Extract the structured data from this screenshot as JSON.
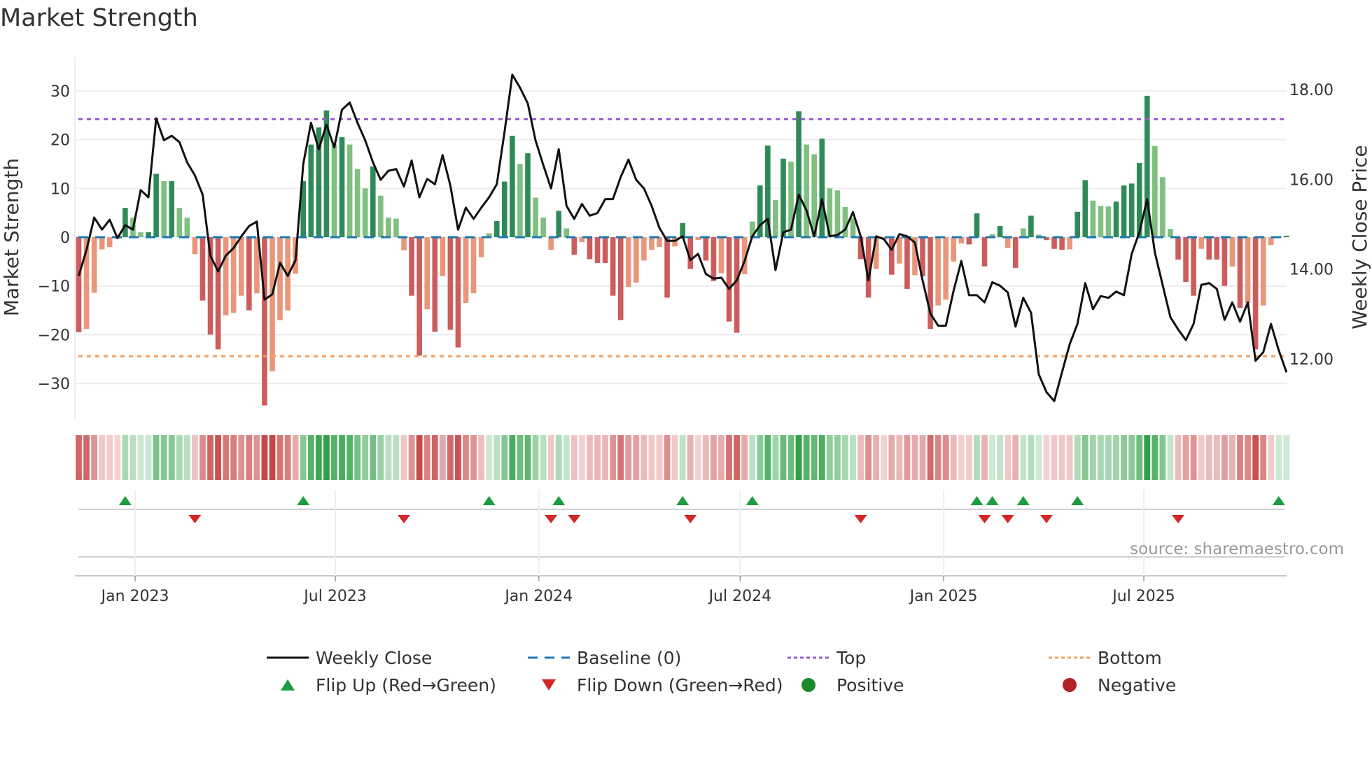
{
  "title": "Market Strength",
  "source": "source: sharemaestro.com",
  "legend": [
    {
      "label": "Weekly Close",
      "symbol": "line",
      "color": "#111111"
    },
    {
      "label": "Baseline (0)",
      "symbol": "dash",
      "color": "#1f77b4"
    },
    {
      "label": "Top",
      "symbol": "dot",
      "color": "#9b59d0"
    },
    {
      "label": "Bottom",
      "symbol": "dot",
      "color": "#f0a060"
    },
    {
      "label": "Flip Up (Red→Green)",
      "symbol": "up",
      "color": "#1a9e3f"
    },
    {
      "label": "Flip Down (Green→Red)",
      "symbol": "down",
      "color": "#d62728"
    },
    {
      "label": "Positive",
      "symbol": "circle",
      "color": "#1a8a2a"
    },
    {
      "label": "Negative",
      "symbol": "circle",
      "color": "#b22222"
    }
  ],
  "colors": {
    "pos_dark": "#2e8b57",
    "pos_light": "#7fbf7f",
    "neg_dark": "#cd5c5c",
    "neg_light": "#e9967a",
    "grid": "#ececf0"
  },
  "chart_data": {
    "type": "bar+line",
    "title": "Market Strength",
    "ylabel": "Market Strength",
    "y2label": "Weekly Close Price",
    "ylim": [
      -37,
      37
    ],
    "y2lim": [
      11.0,
      18.8
    ],
    "yticks": [
      "30",
      "20",
      "10",
      "0",
      "−10",
      "−20",
      "−30"
    ],
    "ytick_values": [
      30,
      20,
      10,
      0,
      -10,
      -20,
      -30
    ],
    "y2ticks": [
      "18.00",
      "16.00",
      "14.00",
      "12.00"
    ],
    "y2tick_values": [
      18,
      16,
      14,
      12
    ],
    "xticks": [
      {
        "label": "Jan 2023",
        "date": "2023-01-01"
      },
      {
        "label": "Jul 2023",
        "date": "2023-07-01"
      },
      {
        "label": "Jan 2024",
        "date": "2024-01-01"
      },
      {
        "label": "Jul 2024",
        "date": "2024-07-01"
      },
      {
        "label": "Jan 2025",
        "date": "2025-01-01"
      },
      {
        "label": "Jul 2025",
        "date": "2025-07-01"
      }
    ],
    "start_date": "2022-11-11",
    "frequency": "weekly",
    "top_level": 24.2,
    "bottom_level": -24.4,
    "baseline": 0,
    "strength": [
      -19.5,
      -18.8,
      -11.4,
      -2.5,
      -2,
      -0.3,
      6,
      4,
      1,
      1,
      13,
      11.5,
      11.5,
      6,
      4,
      -3.5,
      -13,
      -20,
      -23,
      -16,
      -15.5,
      -12,
      -15,
      -11.5,
      -34.5,
      -27.5,
      -17,
      -15,
      -7.5,
      11.5,
      19,
      22.5,
      26,
      19,
      20.5,
      19,
      14,
      10,
      14.5,
      8.5,
      4,
      3.8,
      -2.7,
      -12,
      -24.3,
      -14.8,
      -19.4,
      -8,
      -19,
      -22.6,
      -13.5,
      -11.5,
      -4.1,
      0.8,
      3.3,
      11.4,
      20.8,
      15,
      17.2,
      8.1,
      4,
      -2.6,
      5.4,
      1.8,
      -3.6,
      -1,
      -4.5,
      -5.3,
      -5.3,
      -12,
      -17,
      -10.2,
      -9.3,
      -4.8,
      -2.6,
      -2,
      -12.4,
      -1.9,
      2.9,
      -6.5,
      -0.6,
      -4.8,
      -9,
      -7.4,
      -17.3,
      -19.6,
      -7.6,
      3.2,
      10.6,
      18.8,
      7.6,
      16.1,
      15.5,
      25.8,
      19,
      17,
      20.2,
      10,
      9.6,
      6.2,
      3.9,
      -4.5,
      -12.4,
      -6.5,
      -0.5,
      -7.7,
      -5.4,
      -10.6,
      -7.8,
      -8,
      -18.8,
      -14,
      -12.8,
      -5,
      -1.3,
      -1.5,
      4.9,
      -6,
      0.6,
      2.3,
      -2.2,
      -6.3,
      1.8,
      4.4,
      0.5,
      -0.6,
      -2.4,
      -2.6,
      -2.5,
      5.2,
      11.7,
      7.5,
      6.4,
      6.3,
      7.3,
      10.6,
      11,
      15.2,
      29,
      18.7,
      12.3,
      1.7,
      -4.6,
      -9.2,
      -12,
      -2.4,
      -4.6,
      -4.6,
      -10,
      -6,
      -14.5,
      -13.5,
      -23,
      -14,
      -1.6,
      0.2,
      0.3
    ],
    "weekly_close": [
      13.85,
      14.43,
      15.15,
      14.88,
      15.1,
      14.69,
      14.98,
      14.88,
      15.76,
      15.6,
      17.36,
      16.87,
      16.97,
      16.83,
      16.38,
      16.09,
      15.66,
      14.3,
      13.95,
      14.3,
      14.47,
      14.73,
      14.96,
      15.06,
      13.32,
      13.44,
      14.14,
      13.85,
      14.2,
      16.34,
      17.26,
      16.67,
      17.22,
      16.71,
      17.55,
      17.71,
      17.26,
      16.87,
      16.38,
      15.99,
      16.19,
      16.23,
      15.84,
      16.42,
      15.6,
      16.01,
      15.89,
      16.54,
      15.86,
      14.88,
      15.37,
      15.12,
      15.37,
      15.6,
      15.89,
      17.06,
      18.33,
      18.04,
      17.69,
      16.87,
      16.32,
      15.8,
      16.67,
      15.41,
      15.12,
      15.45,
      15.19,
      15.25,
      15.56,
      15.56,
      16.05,
      16.44,
      15.99,
      15.8,
      15.41,
      14.92,
      14.63,
      14.63,
      14.73,
      14.2,
      14.34,
      13.89,
      13.79,
      13.81,
      13.56,
      13.75,
      14.18,
      14.73,
      14.98,
      15.12,
      13.98,
      14.82,
      14.88,
      15.66,
      15.31,
      14.73,
      15.56,
      14.73,
      14.76,
      14.88,
      15.27,
      14.73,
      13.75,
      14.73,
      14.67,
      14.43,
      14.78,
      14.73,
      14.59,
      13.75,
      13.01,
      12.74,
      12.74,
      13.52,
      14.18,
      13.42,
      13.42,
      13.26,
      13.71,
      13.63,
      13.48,
      12.72,
      13.36,
      13.03,
      11.66,
      11.26,
      11.06,
      11.7,
      12.33,
      12.78,
      13.69,
      13.11,
      13.4,
      13.36,
      13.5,
      13.42,
      14.34,
      14.82,
      15.56,
      14.37,
      13.65,
      12.93,
      12.66,
      12.42,
      12.78,
      13.65,
      13.69,
      13.56,
      12.87,
      13.26,
      12.83,
      13.26,
      11.96,
      12.15,
      12.78,
      12.19,
      11.7
    ]
  }
}
